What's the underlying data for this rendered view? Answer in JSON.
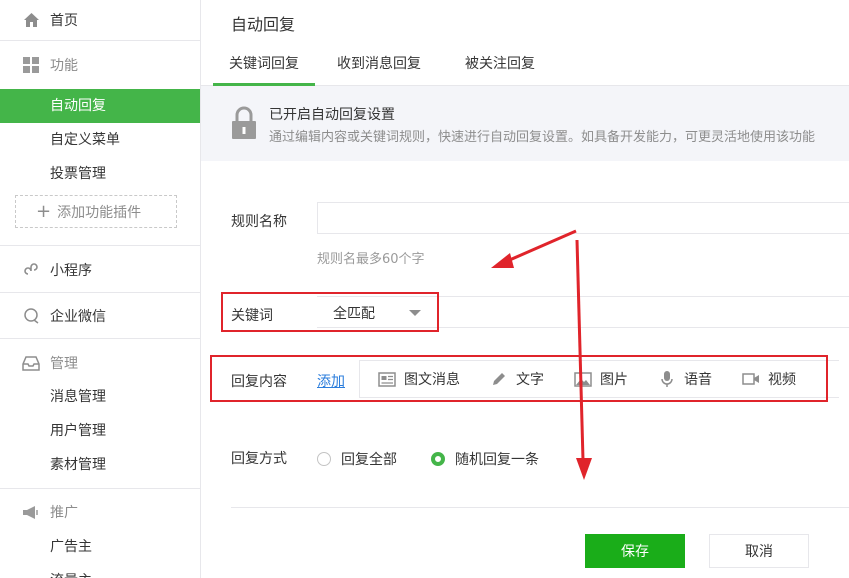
{
  "sidebar": {
    "home": "首页",
    "function_section": "功能",
    "function_items": [
      "自动回复",
      "自定义菜单",
      "投票管理"
    ],
    "add_plugin": "添加功能插件",
    "mini_program": "小程序",
    "enterprise_wechat": "企业微信",
    "manage_section": "管理",
    "manage_items": [
      "消息管理",
      "用户管理",
      "素材管理"
    ],
    "promote_section": "推广",
    "promote_items": [
      "广告主",
      "流量主"
    ]
  },
  "main": {
    "title": "自动回复",
    "tabs": [
      "关键词回复",
      "收到消息回复",
      "被关注回复"
    ],
    "notice_title": "已开启自动回复设置",
    "notice_desc": "通过编辑内容或关键词规则，快速进行自动回复设置。如具备开发能力，可更灵活地使用该功能",
    "rule_name_label": "规则名称",
    "rule_name_value": "",
    "rule_name_hint": "规则名最多60个字",
    "keyword_label": "关键词",
    "keyword_match": "全匹配",
    "reply_content_label": "回复内容",
    "reply_add": "添加",
    "reply_tools": [
      "图文消息",
      "文字",
      "图片",
      "语音",
      "视频"
    ],
    "reply_mode_label": "回复方式",
    "reply_modes": [
      "回复全部",
      "随机回复一条"
    ],
    "selected_reply_mode": "随机回复一条",
    "save": "保存",
    "cancel": "取消"
  },
  "colors": {
    "accent": "#44b549",
    "annotation": "#e0242b",
    "link": "#2b7ddc"
  }
}
